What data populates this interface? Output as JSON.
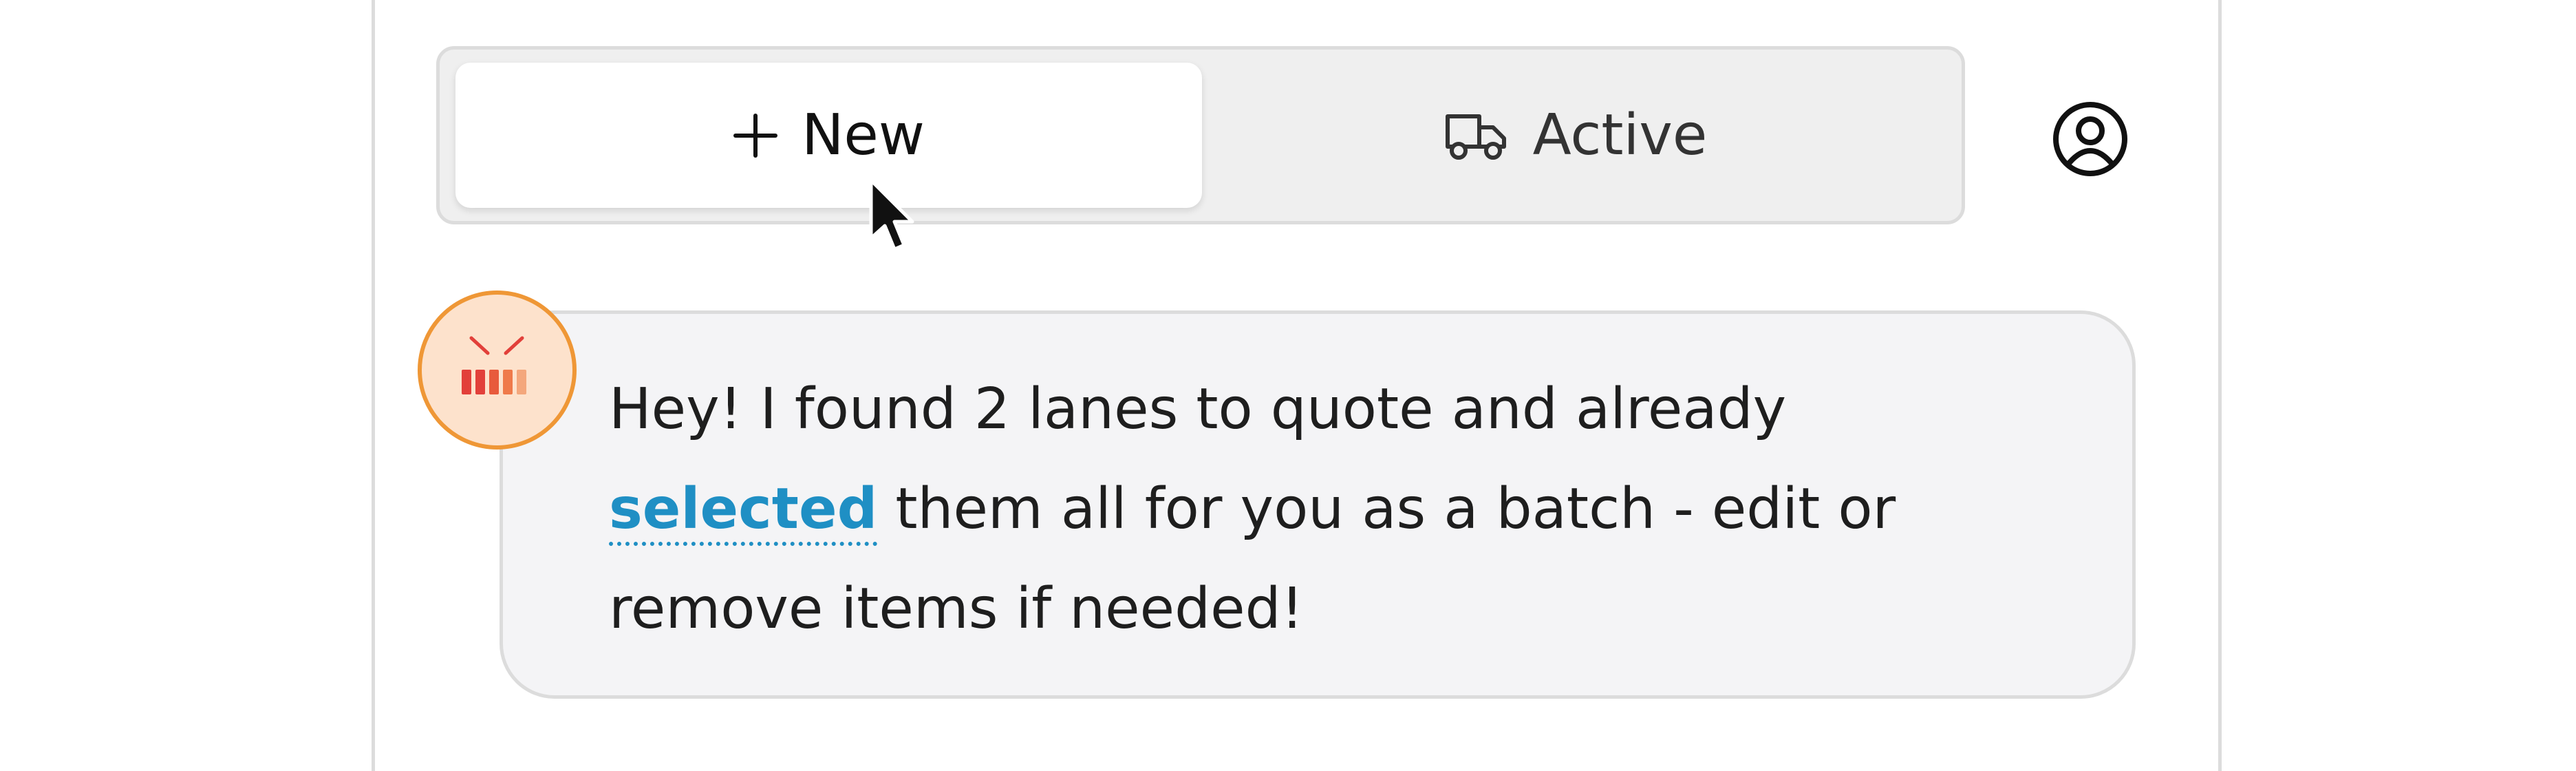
{
  "tabs": {
    "new_label": "New",
    "active_label": "Active"
  },
  "message": {
    "part1": "Hey! I found 2 lanes to quote and already ",
    "link_text": "selected",
    "part2": " them all for you as a batch - edit or remove items if needed!"
  },
  "colors": {
    "accent_link": "#1f8fc4",
    "avatar_border": "#ef9736",
    "avatar_fill": "#fde2cc",
    "logo_red": "#e2403a"
  },
  "icons": {
    "new_tab": "plus-icon",
    "active_tab": "truck-icon",
    "account": "user-circle-icon",
    "bot": "bot-logo-icon"
  }
}
